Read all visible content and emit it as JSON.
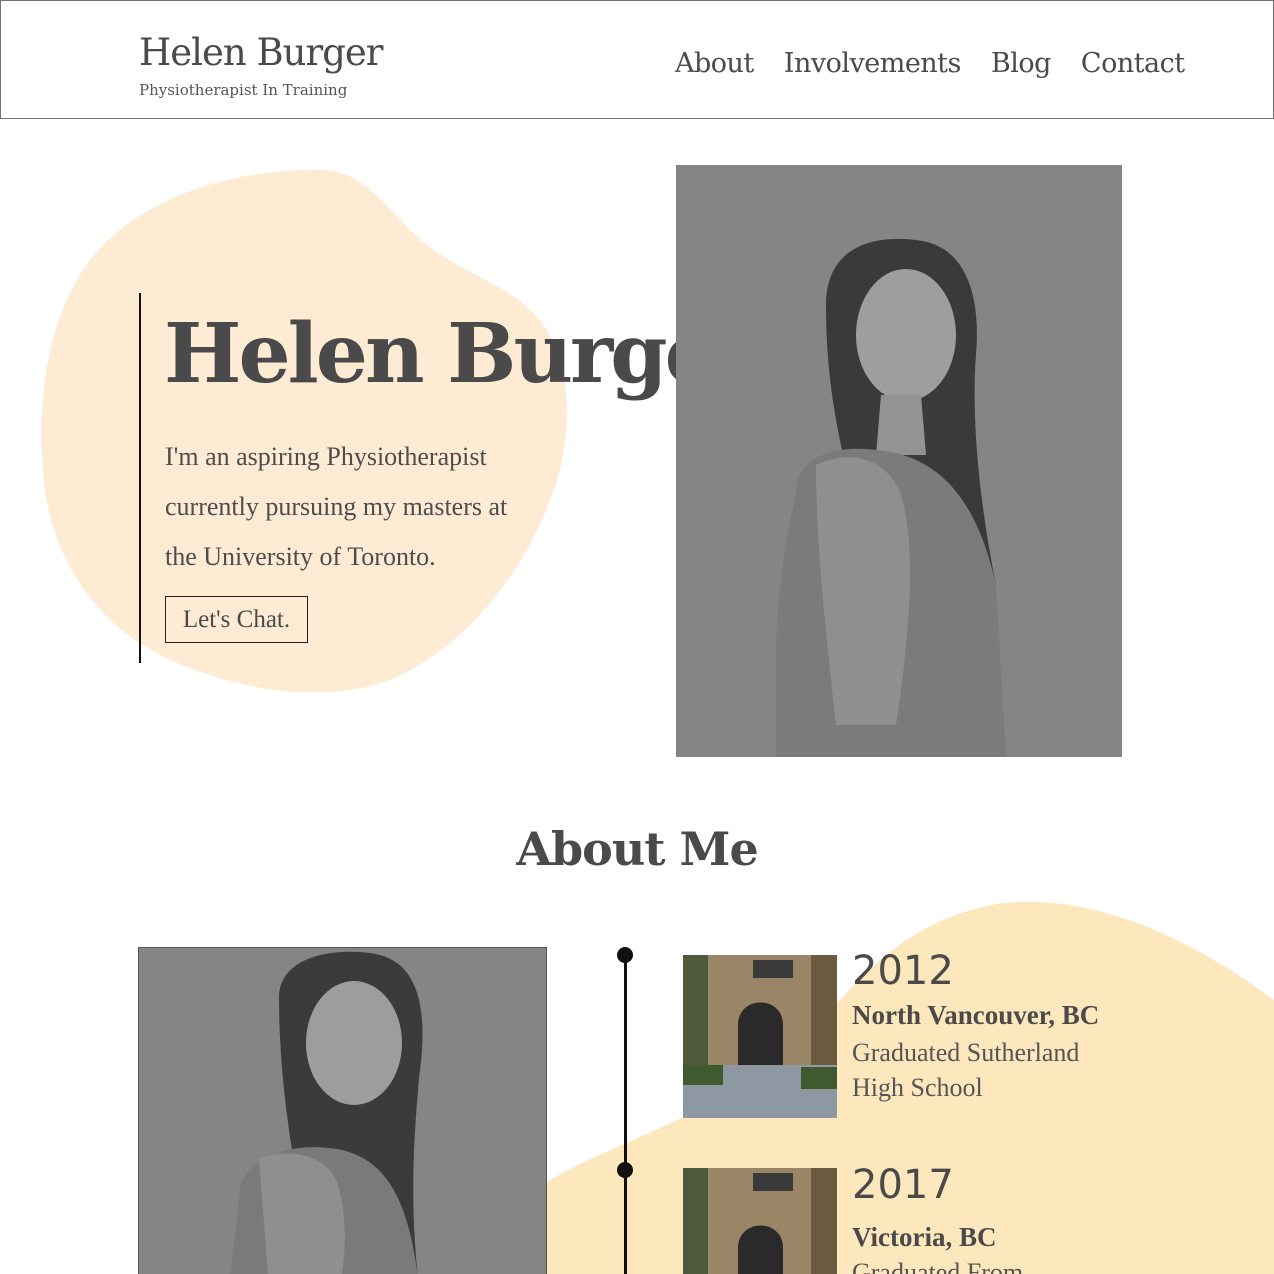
{
  "header": {
    "brand_name": "Helen Burger",
    "tagline": "Physiotherapist In Training",
    "nav": [
      "About",
      "Involvements",
      "Blog",
      "Contact"
    ]
  },
  "hero": {
    "title": "Helen Burger",
    "description": "I'm an aspiring Physiotherapist currently pursuing my masters at the University of Toronto.",
    "cta_label": "Let's Chat."
  },
  "about": {
    "heading": "About Me",
    "timeline": [
      {
        "year": "2012",
        "place": "North Vancouver, BC",
        "description": "Graduated Sutherland High School"
      },
      {
        "year": "2017",
        "place": "Victoria, BC",
        "description": "Graduated From"
      }
    ]
  },
  "colors": {
    "hero_blob": "#fdebd3",
    "about_blob": "#fde8bd",
    "text": "#4a4a4a"
  }
}
